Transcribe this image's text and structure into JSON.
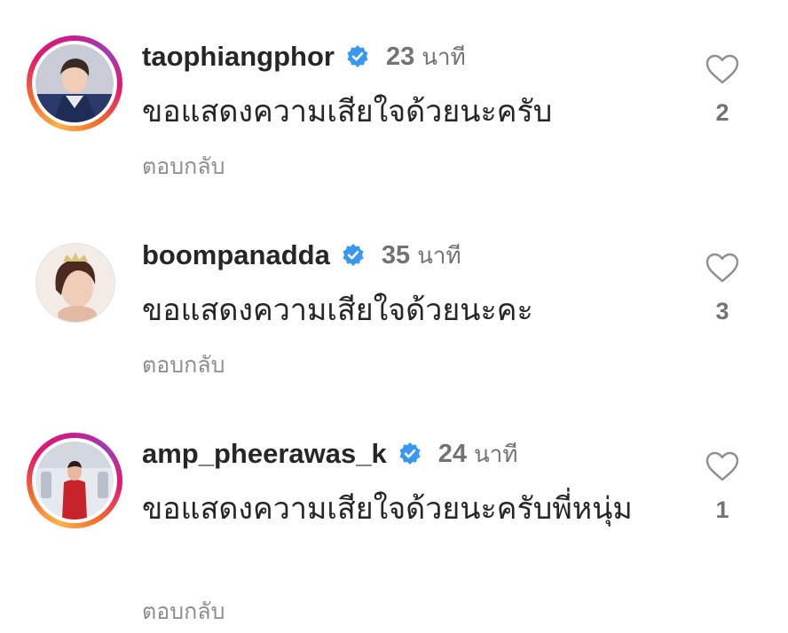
{
  "comments": [
    {
      "username": "taophiangphor",
      "verified": true,
      "time_value": "23",
      "time_unit": "นาที",
      "text": "ขอแสดงความเสียใจด้วยนะครับ",
      "reply_label": "ตอบกลับ",
      "likes": "2",
      "avatar_icon": "avatar-photo",
      "story_ring": true
    },
    {
      "username": "boompanadda",
      "verified": true,
      "time_value": "35",
      "time_unit": "นาที",
      "text": "ขอแสดงความเสียใจด้วยนะคะ",
      "reply_label": "ตอบกลับ",
      "likes": "3",
      "avatar_icon": "avatar-photo",
      "story_ring": false
    },
    {
      "username": "amp_pheerawas_k",
      "verified": true,
      "time_value": "24",
      "time_unit": "นาที",
      "text": "ขอแสดงความเสียใจด้วยนะครับพี่หนุ่ม",
      "reply_label": "ตอบกลับ",
      "likes": "1",
      "avatar_icon": "avatar-photo",
      "story_ring": true
    }
  ],
  "colors": {
    "verified_badge": "#3897f0",
    "secondary_text": "#737373",
    "primary_text": "#262626"
  }
}
